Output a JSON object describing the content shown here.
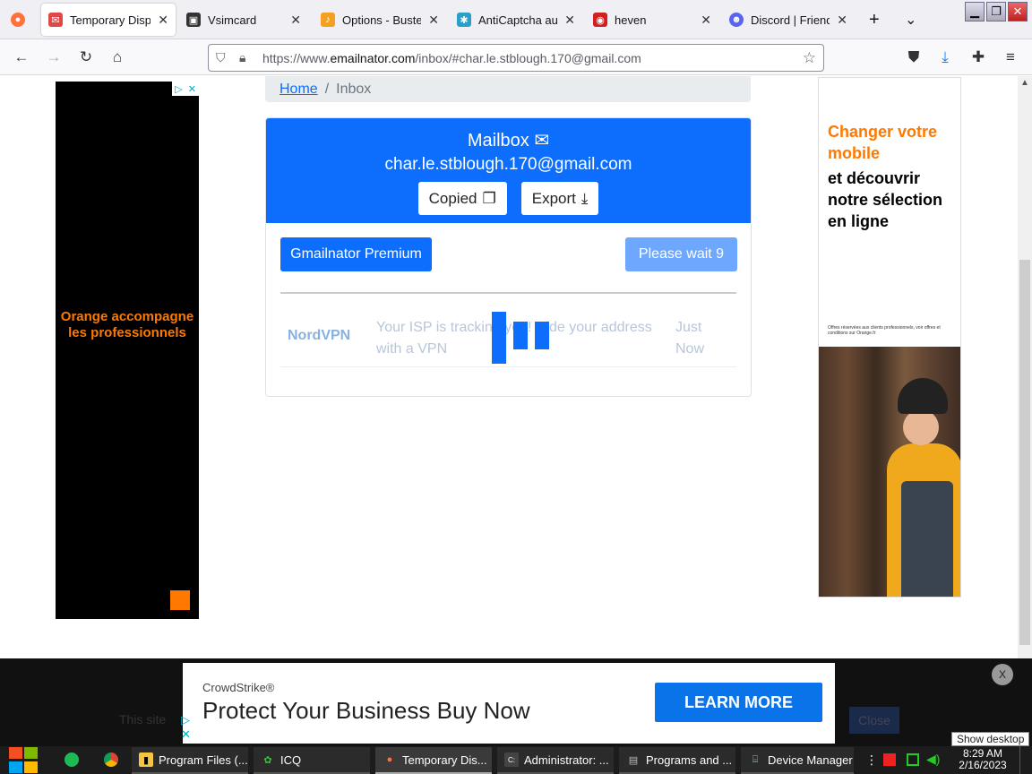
{
  "browser": {
    "tabs": [
      {
        "label": "Temporary Dispo",
        "color": "#e04848",
        "glyph": "✉"
      },
      {
        "label": "Vsimcard",
        "color": "#333333",
        "glyph": "▣"
      },
      {
        "label": "Options - Buster",
        "color": "#f4a020",
        "glyph": "♪"
      },
      {
        "label": "AntiCaptcha auto",
        "color": "#2aa0c8",
        "glyph": "✱"
      },
      {
        "label": "heven",
        "color": "#d02020",
        "glyph": "◉"
      },
      {
        "label": "Discord | Friends",
        "color": "#5865f2",
        "glyph": "☻"
      }
    ],
    "new_tab": "+",
    "tab_list": "⌄",
    "url_prefix": "https://www.",
    "url_domain": "emailnator.com",
    "url_path": "/inbox/#char.le.stblough.170@gmail.com"
  },
  "page": {
    "breadcrumb": {
      "home": "Home",
      "separator": "/",
      "current": "Inbox"
    },
    "mailbox": {
      "title": "Mailbox",
      "email": "char.le.stblough.170@gmail.com",
      "copied_label": "Copied",
      "export_label": "Export"
    },
    "premium_label": "Gmailnator Premium",
    "wait_label": "Please wait 9",
    "message": {
      "from": "NordVPN",
      "subject": "Your ISP is tracking you! Hide your address with a VPN",
      "time": "Just Now"
    },
    "ad_left": {
      "text": "Orange accompagne les professionnels"
    },
    "ad_right": {
      "headline": "Changer votre mobile",
      "subline": "et découvrir notre sélection en ligne",
      "fine_print": "Offres réservées aux clients professionnels, voir offres et conditions sur Orange.fr"
    }
  },
  "consent": {
    "text": "This site",
    "close_label": "Close"
  },
  "banner_ad": {
    "brand": "CrowdStrike®",
    "headline": "Protect Your Business Buy Now",
    "cta": "LEARN MORE",
    "close": "X"
  },
  "taskbar": {
    "items": [
      {
        "label": "Program Files (...",
        "color": "#f4c542",
        "glyph": "▮"
      },
      {
        "label": "ICQ",
        "color": "#3fbf3f",
        "glyph": "✿"
      },
      {
        "label": "Temporary Dis...",
        "color": "#ff7139",
        "glyph": "●"
      },
      {
        "label": "Administrator: ...",
        "color": "#444444",
        "glyph": "C:"
      },
      {
        "label": "Programs and ...",
        "color": "#888888",
        "glyph": "▤"
      },
      {
        "label": "Device Manager",
        "color": "#6688aa",
        "glyph": "⌸"
      }
    ],
    "time": "8:29 AM",
    "date": "2/16/2023",
    "show_desktop": "Show desktop"
  },
  "colors": {
    "accent": "#0d6efd",
    "orange": "#ff7900"
  }
}
